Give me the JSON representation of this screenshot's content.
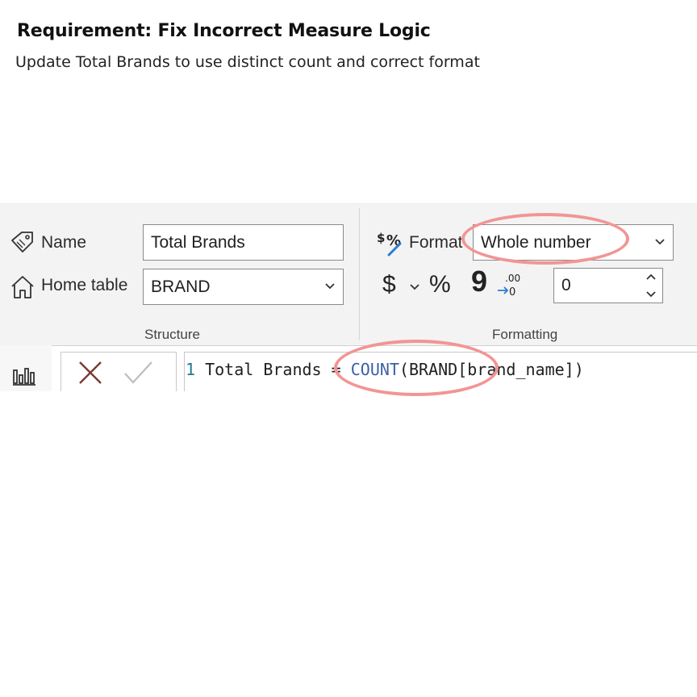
{
  "header": {
    "title": "Requirement: Fix Incorrect Measure Logic",
    "subtitle": "Update Total Brands to use distinct count and correct format"
  },
  "structure": {
    "name_label": "Name",
    "name_value": "Total Brands",
    "home_table_label": "Home table",
    "home_table_value": "BRAND",
    "group_label": "Structure"
  },
  "formatting": {
    "format_label": "Format",
    "format_value": "Whole number",
    "currency_symbol": "$",
    "percent_symbol": "%",
    "comma_symbol": "9",
    "decimal_places": "0",
    "group_label": "Formatting"
  },
  "formula": {
    "line_number": "1",
    "measure_name": "Total Brands",
    "operator": "=",
    "function": "COUNT",
    "open_paren": "(",
    "table": "BRAND",
    "column": "[brand_name]",
    "close_paren": ")"
  },
  "annotation_color": "#f29595"
}
